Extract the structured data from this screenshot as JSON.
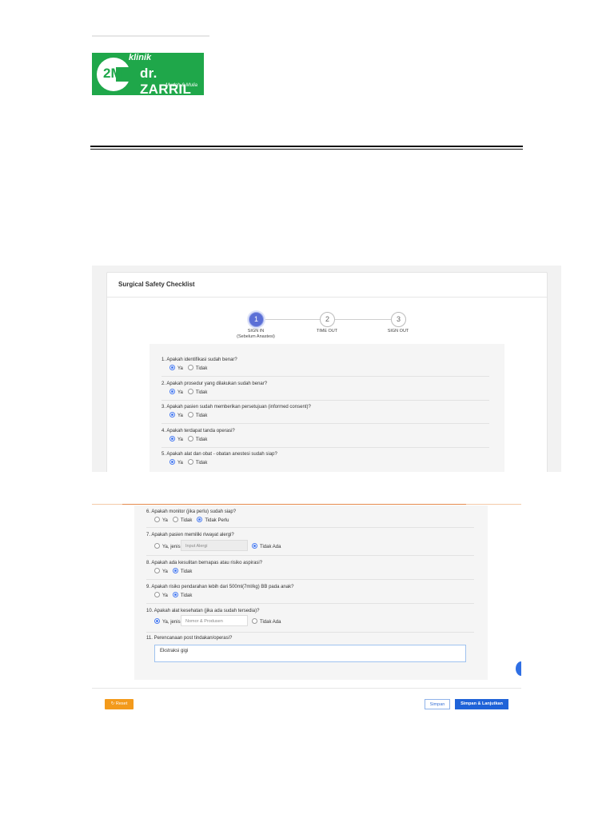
{
  "logo": {
    "mark": "2M",
    "prefix": "klinik",
    "name": "dr. ZARRIL",
    "tagline": "Mudah & Mulia",
    "color": "#1fa74a"
  },
  "checklist": {
    "title": "Surgical Safety Checklist",
    "steps": [
      {
        "number": "1",
        "label": "SIGN IN",
        "sub": "(Sebelum Anastesi)",
        "active": true
      },
      {
        "number": "2",
        "label": "TIME OUT",
        "sub": "",
        "active": false
      },
      {
        "number": "3",
        "label": "SIGN OUT",
        "sub": "",
        "active": false
      }
    ],
    "questions": [
      {
        "text": "1. Apakah identifikasi sudah benar?",
        "opt1": "Ya",
        "opt2": "Tidak",
        "selected": "Ya"
      },
      {
        "text": "2. Apakah prosedur yang dilakukan sudah benar?",
        "opt1": "Ya",
        "opt2": "Tidak",
        "selected": "Ya"
      },
      {
        "text": "3. Apakah pasien sudah memberikan persetujuan (informed consent)?",
        "opt1": "Ya",
        "opt2": "Tidak",
        "selected": "Ya"
      },
      {
        "text": "4. Apakah terdapat tanda operasi?",
        "opt1": "Ya",
        "opt2": "Tidak",
        "selected": "Ya"
      },
      {
        "text": "5. Apakah alat dan obat - obatan anestesi sudah siap?",
        "opt1": "Ya",
        "opt2": "Tidak",
        "selected": "Ya"
      }
    ]
  },
  "form2": {
    "q6": {
      "text": "6. Apakah monitor (jika perlu) sudah siap?",
      "opt1": "Ya",
      "opt2": "Tidak",
      "opt3": "Tidak Perlu",
      "selected": "Tidak Perlu"
    },
    "q7": {
      "text": "7. Apakah pasien memiliki riwayat alergi?",
      "opt1": "Ya, jenis",
      "input_placeholder": "Input Alergi",
      "opt2": "Tidak Ada",
      "selected": "Tidak Ada"
    },
    "q8": {
      "text": "8. Apakah ada kesulitan bernapas atau risiko aspirasi?",
      "opt1": "Ya",
      "opt2": "Tidak",
      "selected": "Tidak"
    },
    "q9": {
      "text": "9. Apakah risiko pendarahan lebih dari 500ml(7ml/kg) BB pada anak?",
      "opt1": "Ya",
      "opt2": "Tidak",
      "selected": "Tidak"
    },
    "q10": {
      "text": "10. Apakah alat kesehatan (jika ada sudah tersedia)?",
      "opt1": "Ya, jenis",
      "input_placeholder": "Nomor & Produsen",
      "opt2": "Tidak Ada",
      "selected": "Ya, jenis"
    },
    "q11": {
      "text": "11. Perencanaan post tindakan/operasi?",
      "value": "Ekstraksi gigi"
    }
  },
  "buttons": {
    "reset": "Reset",
    "simpan": "Simpan",
    "simpan_lanjut": "Simpan & Lanjutkan"
  },
  "colors": {
    "accent": "#1f63d8",
    "reset": "#f39a1b",
    "step_active": "#5b6fd6"
  }
}
